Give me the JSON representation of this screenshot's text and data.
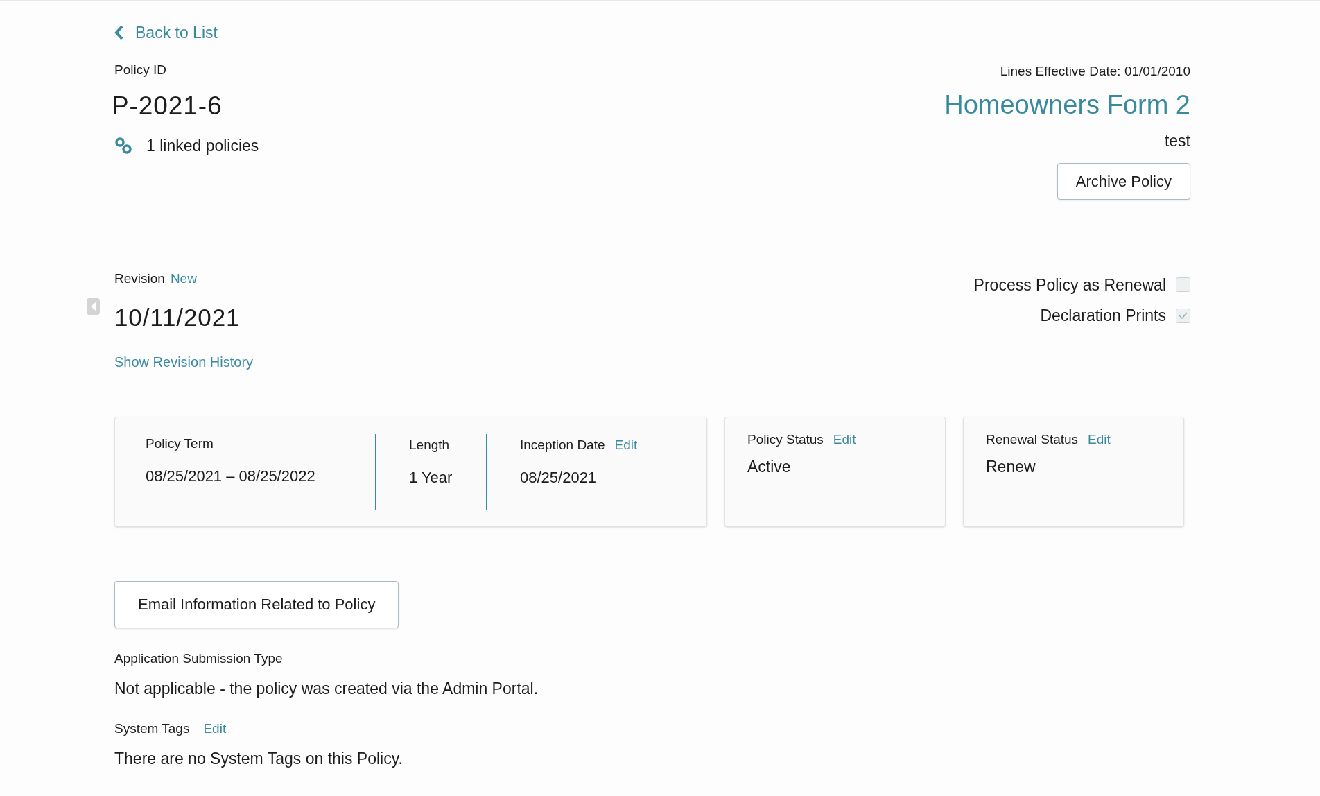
{
  "back_link": "Back to List",
  "policy": {
    "id_label": "Policy ID",
    "id": "P-2021-6",
    "linked": "1 linked policies"
  },
  "product": {
    "lines_effective": "Lines Effective Date: 01/01/2010",
    "name": "Homeowners Form 2",
    "subtitle": "test",
    "archive_button": "Archive Policy"
  },
  "revision": {
    "label": "Revision",
    "tag": "New",
    "date": "10/11/2021",
    "history_link": "Show Revision History"
  },
  "options": [
    {
      "label": "Process Policy as Renewal",
      "checked": false
    },
    {
      "label": "Declaration Prints",
      "checked": true
    }
  ],
  "term_card": [
    {
      "label": "Policy Term",
      "value": "08/25/2021 – 08/25/2022"
    },
    {
      "label": "Length",
      "value": "1 Year"
    },
    {
      "label": "Inception Date",
      "edit": "Edit",
      "value": "08/25/2021"
    }
  ],
  "status_cards": [
    {
      "label": "Policy Status",
      "edit": "Edit",
      "value": "Active"
    },
    {
      "label": "Renewal Status",
      "edit": "Edit",
      "value": "Renew"
    }
  ],
  "email_button": "Email Information Related to Policy",
  "submission": {
    "label": "Application Submission Type",
    "value": "Not applicable - the policy was created via the Admin Portal."
  },
  "tags": {
    "label": "System Tags",
    "edit": "Edit",
    "value": "There are no System Tags on this Policy."
  }
}
